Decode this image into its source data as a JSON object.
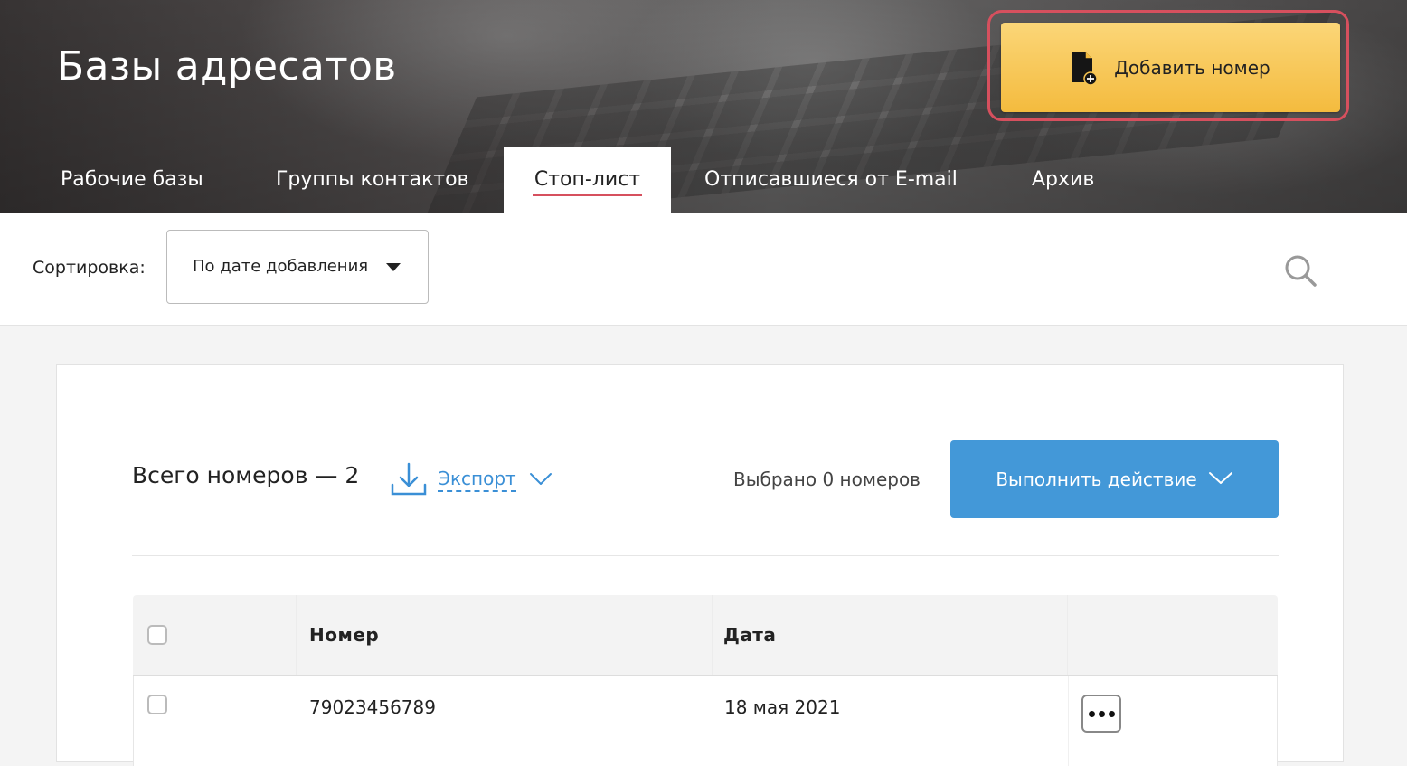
{
  "header": {
    "title": "Базы адресатов",
    "add_button_label": "Добавить номер",
    "tabs": [
      {
        "label": "Рабочие базы",
        "active": false
      },
      {
        "label": "Группы контактов",
        "active": false
      },
      {
        "label": "Стоп-лист",
        "active": true
      },
      {
        "label": "Отписавшиеся от E-mail",
        "active": false
      },
      {
        "label": "Архив",
        "active": false
      }
    ]
  },
  "sort": {
    "label": "Сортировка:",
    "selected": "По дате добавления"
  },
  "summary": {
    "total": "Всего номеров — 2",
    "export_label": "Экспорт",
    "selected_text": "Выбрано 0 номеров",
    "action_button_label": "Выполнить действие"
  },
  "table": {
    "columns": [
      "Номер",
      "Дата"
    ],
    "rows": [
      {
        "number": "79023456789",
        "date": "18 мая 2021"
      }
    ]
  },
  "colors": {
    "accent_red": "#d6505e",
    "add_button": "#f4bb3e",
    "action_blue": "#4398d8",
    "link_blue": "#3a8fd6"
  },
  "icons": [
    "file-add-icon",
    "search-icon",
    "download-icon",
    "chevron-down-icon",
    "more-options-icon"
  ]
}
